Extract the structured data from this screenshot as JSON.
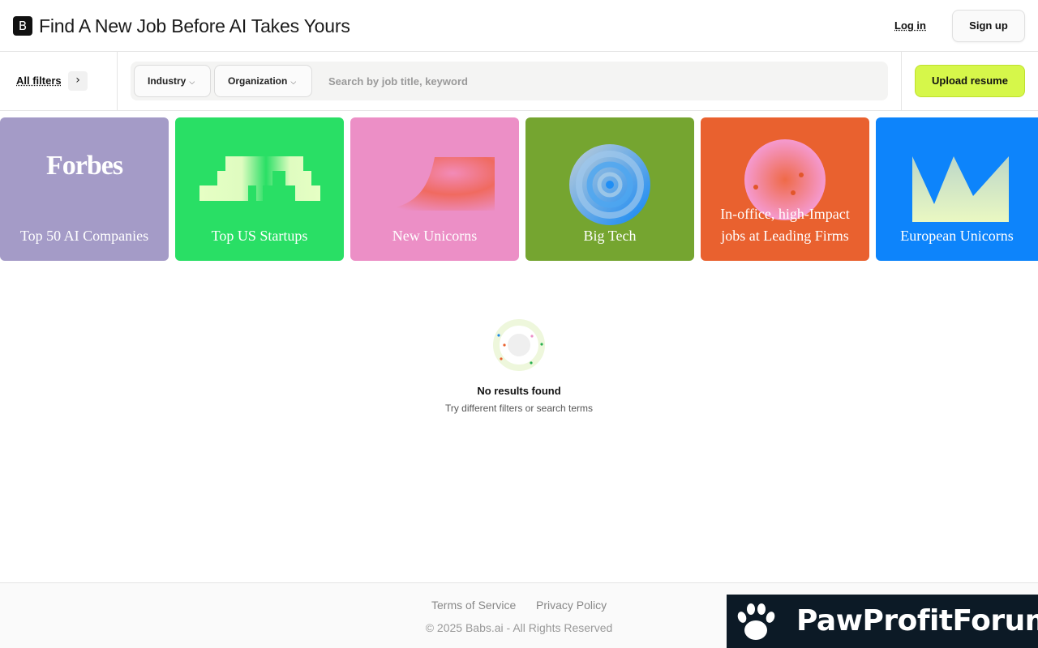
{
  "header": {
    "logo_letter": "B",
    "title": "Find A New Job Before AI Takes Yours",
    "login_label": "Log in",
    "signup_label": "Sign up"
  },
  "filters": {
    "all_filters_label": "All filters",
    "industry_label": "Industry",
    "organization_label": "Organization",
    "search_placeholder": "Search by job title, keyword",
    "upload_label": "Upload resume"
  },
  "cards": [
    {
      "label": "Top 50 AI Companies",
      "logo_text": "Forbes",
      "bg": "#a49bc7"
    },
    {
      "label": "Top US Startups",
      "bg": "#29df65"
    },
    {
      "label": "New Unicorns",
      "bg": "#ec8fc6"
    },
    {
      "label": "Big Tech",
      "bg": "#75a530"
    },
    {
      "label_line1": "In-office, high-Impact",
      "label_line2": "jobs at Leading Firms",
      "bg": "#e9612f"
    },
    {
      "label": "European Unicorns",
      "bg": "#0d84fb"
    }
  ],
  "empty_state": {
    "title": "No results found",
    "subtitle": "Try different filters or search terms"
  },
  "footer": {
    "terms": "Terms of Service",
    "privacy": "Privacy Policy",
    "copyright": "© 2025 Babs.ai - All Rights Reserved"
  },
  "watermark": {
    "text": "PawProfitForum"
  },
  "colors": {
    "accent": "#d6f74a",
    "badge_bg": "#0c1a26"
  }
}
